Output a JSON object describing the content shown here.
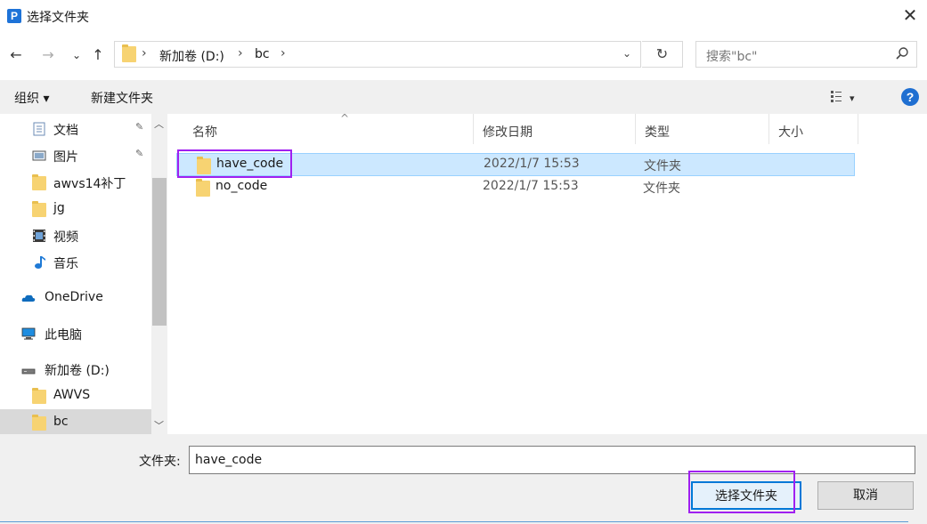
{
  "title": "选择文件夹",
  "app_icon_letter": "P",
  "close_glyph": "✕",
  "nav": {
    "back": "←",
    "forward": "→",
    "recent": "⌄",
    "up": "↑"
  },
  "address": {
    "sep": "›",
    "crumbs": [
      "新加卷 (D:)",
      "bc"
    ],
    "dropdown": "⌄",
    "refresh": "↻"
  },
  "search": {
    "placeholder": "搜索\"bc\""
  },
  "toolbar": {
    "organize": "组织 ▾",
    "new_folder": "新建文件夹",
    "view_dropdown": "▾",
    "help": "?"
  },
  "sidebar": {
    "items": [
      {
        "label": "文档",
        "icon": "document-icon",
        "pinned": true
      },
      {
        "label": "图片",
        "icon": "picture-icon",
        "pinned": true
      },
      {
        "label": "awvs14补丁",
        "icon": "folder-icon",
        "pinned": false
      },
      {
        "label": "jg",
        "icon": "folder-icon",
        "pinned": false
      },
      {
        "label": "视频",
        "icon": "video-icon",
        "pinned": false
      },
      {
        "label": "音乐",
        "icon": "music-icon",
        "pinned": false
      },
      {
        "label": "OneDrive",
        "icon": "onedrive-icon",
        "pinned": false
      },
      {
        "label": "此电脑",
        "icon": "computer-icon",
        "pinned": false
      },
      {
        "label": "新加卷 (D:)",
        "icon": "drive-icon",
        "pinned": false
      },
      {
        "label": "AWVS",
        "icon": "folder-icon",
        "pinned": false
      },
      {
        "label": "bc",
        "icon": "folder-icon",
        "pinned": false,
        "selected": true
      }
    ],
    "pin_glyph": "📌"
  },
  "columns": {
    "name": "名称",
    "date": "修改日期",
    "type": "类型",
    "size": "大小",
    "sort_glyph": "^"
  },
  "files": [
    {
      "name": "have_code",
      "date": "2022/1/7 15:53",
      "type": "文件夹",
      "selected": true
    },
    {
      "name": "no_code",
      "date": "2022/1/7 15:53",
      "type": "文件夹",
      "selected": false
    }
  ],
  "footer": {
    "folder_label": "文件夹:",
    "folder_value": "have_code",
    "select_button": "选择文件夹",
    "cancel_button": "取消"
  },
  "colors": {
    "selection": "#cce8ff",
    "highlight_box": "#a020f0",
    "accent": "#0078d7"
  }
}
